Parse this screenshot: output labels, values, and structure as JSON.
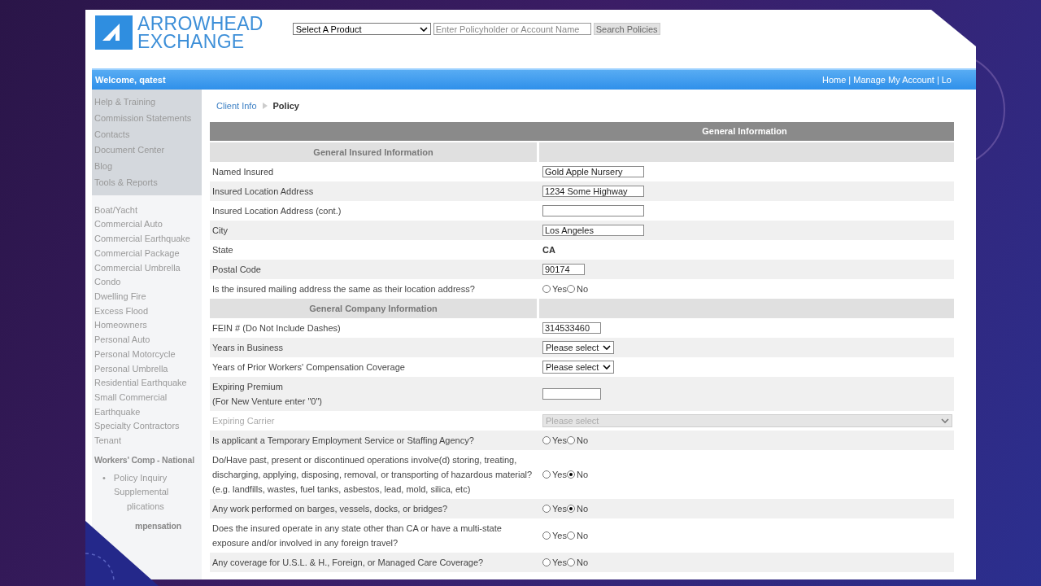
{
  "header": {
    "logo": {
      "line1": "ARROWHEAD",
      "line2": "EXCHANGE"
    },
    "product_select": "Select A Product",
    "search": {
      "placeholder": "Enter Policyholder or Account Name"
    },
    "search_button": "Search Policies"
  },
  "nav_bar": {
    "welcome": "Welcome, qatest",
    "separator": "|",
    "links": [
      "Home",
      "Manage My Account",
      "Lo"
    ]
  },
  "sidebar": {
    "top_links": [
      "Help & Training",
      "Commission Statements",
      "Contacts",
      "Document Center",
      "Blog",
      "Tools & Reports"
    ],
    "products": [
      "Boat/Yacht",
      "Commercial Auto",
      "Commercial Earthquake",
      "Commercial Package",
      "Commercial Umbrella",
      "Condo",
      "Dwelling Fire",
      "Excess Flood",
      "Homeowners",
      "Personal Auto",
      "Personal Motorcycle",
      "Personal Umbrella",
      "Residential Earthquake",
      "Small Commercial Earthquake",
      "Specialty Contractors",
      "Tenant"
    ],
    "section_title": "Workers' Comp - National",
    "bullet": "•",
    "sub_items": [
      "Policy Inquiry",
      "Supplemental",
      "plications"
    ],
    "cut_title": "mpensation"
  },
  "breadcrumb": [
    "Client Info",
    "Policy"
  ],
  "form": {
    "title": "General Information",
    "rows": [
      {
        "kind": "section",
        "label": "General Insured Information"
      },
      {
        "kind": "text",
        "label": [
          "Named Insured"
        ],
        "value": "Gold Apple Nursery"
      },
      {
        "kind": "text",
        "label": [
          "Insured Location Address"
        ],
        "value": "1234 Some Highway"
      },
      {
        "kind": "text",
        "label": [
          "Insured Location Address (cont.)"
        ]
      },
      {
        "kind": "text",
        "label": [
          "City"
        ],
        "value": "Los Angeles"
      },
      {
        "kind": "static",
        "label": [
          "State"
        ],
        "value": "CA"
      },
      {
        "kind": "code",
        "label": [
          "Postal Code"
        ],
        "value": "90174"
      },
      {
        "kind": "radio",
        "label": [
          "Is the insured mailing address the same as their location address?"
        ],
        "options": [
          {
            "label": "Yes",
            "selected": false
          },
          {
            "label": "No",
            "selected": false
          }
        ]
      },
      {
        "kind": "section",
        "label": "General Company Information"
      },
      {
        "kind": "number",
        "label": [
          "FEIN # (Do Not Include Dashes)"
        ],
        "value": "314533460"
      },
      {
        "kind": "select",
        "label": [
          "Years in Business"
        ],
        "value": "Please select"
      },
      {
        "kind": "select",
        "label": [
          "Years of Prior Workers' Compensation Coverage"
        ],
        "value": "Please select"
      },
      {
        "kind": "number",
        "label": [
          "Expiring Premium",
          "(For New Venture enter \"0\")"
        ]
      },
      {
        "kind": "wide-select",
        "label": [
          "Expiring Carrier"
        ],
        "value": "Please select",
        "disabled": true
      },
      {
        "kind": "radio",
        "label": [
          "Is applicant a Temporary Employment Service or Staffing Agency?"
        ],
        "options": [
          {
            "label": "Yes",
            "selected": false
          },
          {
            "label": "No",
            "selected": false
          }
        ]
      },
      {
        "kind": "radio",
        "label": [
          "Do/Have past, present or discontinued operations involve(d) storing, treating,",
          "discharging, applying, disposing, removal, or transporting of hazardous material?",
          "(e.g. landfills, wastes, fuel tanks, asbestos, lead, mold, silica, etc)"
        ],
        "options": [
          {
            "label": "Yes",
            "selected": false
          },
          {
            "label": "No",
            "selected": true
          }
        ]
      },
      {
        "kind": "radio",
        "label": [
          "Any work performed on barges, vessels, docks, or bridges?"
        ],
        "options": [
          {
            "label": "Yes",
            "selected": false
          },
          {
            "label": "No",
            "selected": true
          }
        ]
      },
      {
        "kind": "radio",
        "label": [
          "Does the insured operate in any state other than CA or have a multi-state",
          "exposure and/or involved in any foreign travel?"
        ],
        "options": [
          {
            "label": "Yes",
            "selected": false
          },
          {
            "label": "No",
            "selected": false
          }
        ]
      },
      {
        "kind": "radio",
        "label": [
          "Any coverage for U.S.L. & H., Foreign, or Managed Care Coverage?"
        ],
        "options": [
          {
            "label": "Yes",
            "selected": false
          },
          {
            "label": "No",
            "selected": false
          }
        ]
      }
    ]
  }
}
